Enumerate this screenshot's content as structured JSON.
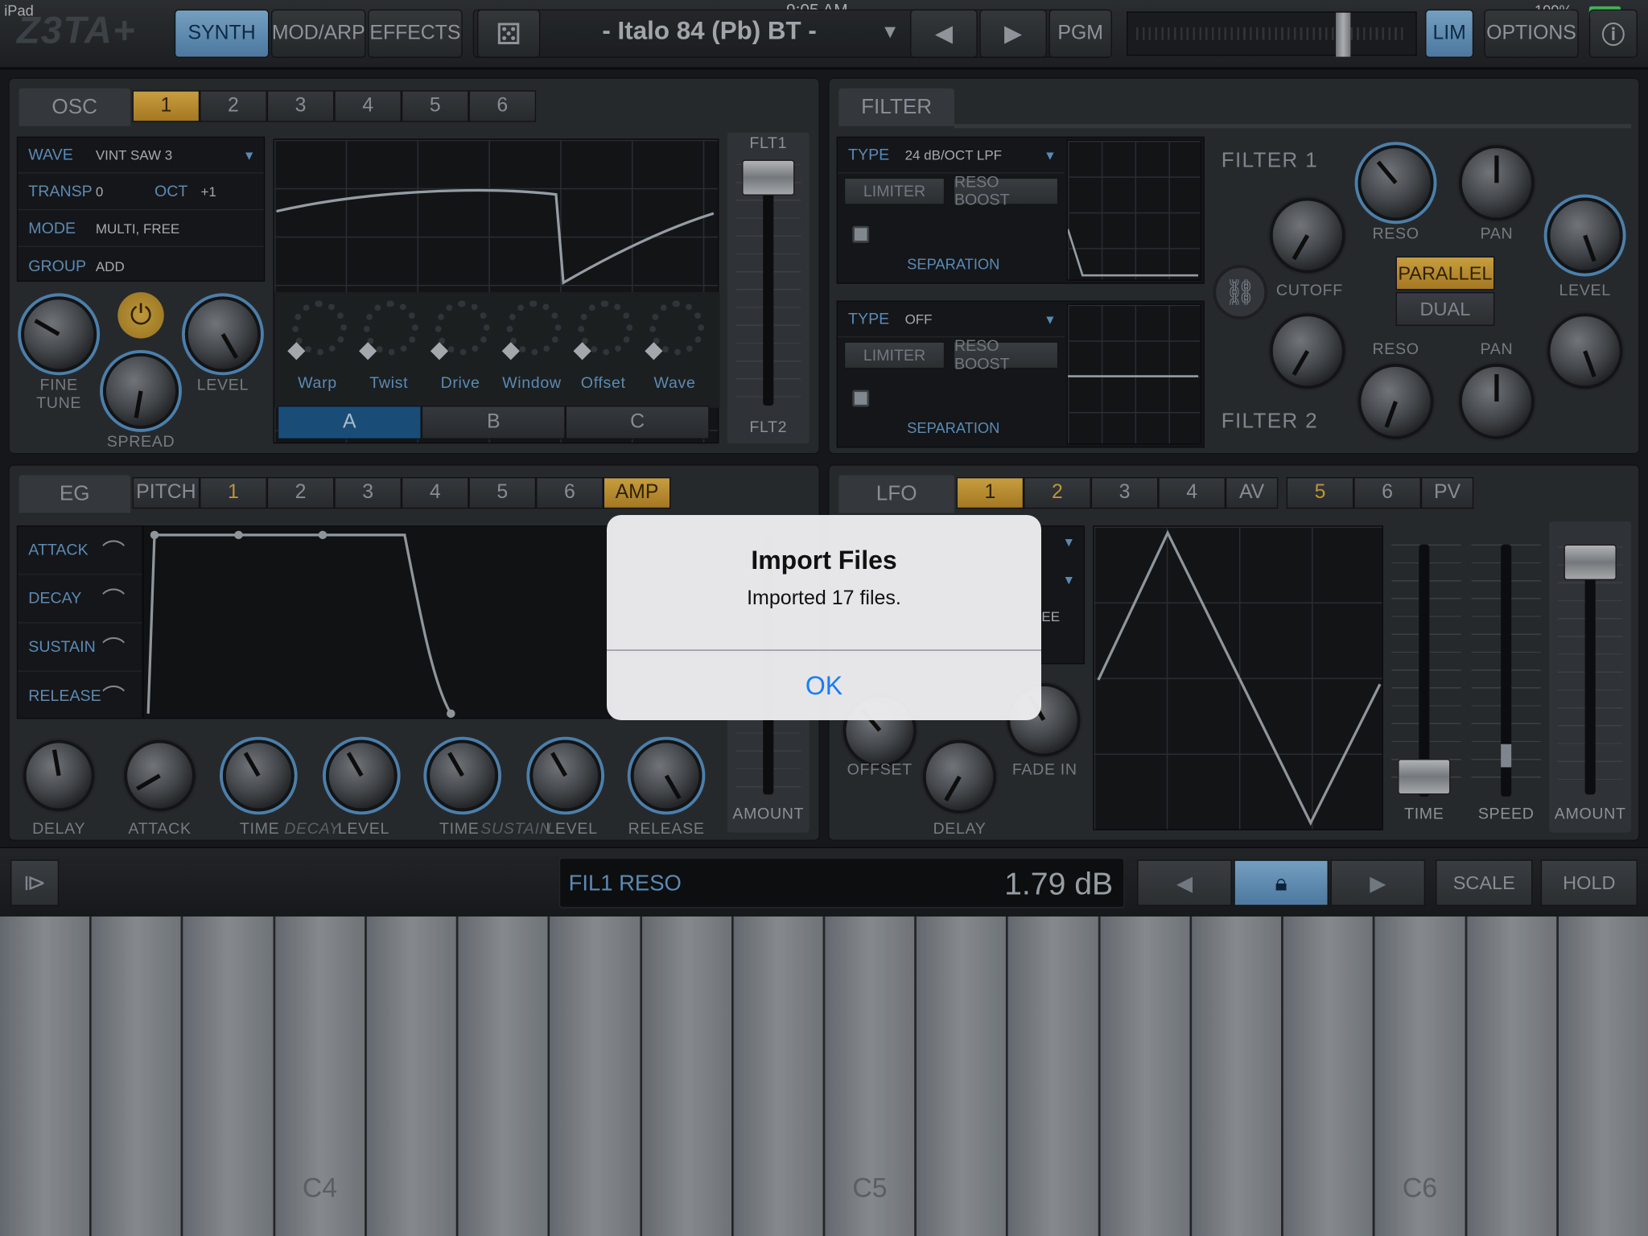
{
  "status_bar": {
    "device": "iPad",
    "time": "9:05 AM",
    "battery": "100%"
  },
  "topbar": {
    "logo": "Z3TA+",
    "tabs": [
      {
        "label": "SYNTH",
        "active": true
      },
      {
        "label": "MOD/ARP",
        "active": false
      },
      {
        "label": "EFFECTS",
        "active": false
      }
    ],
    "preset_name": "- Italo 84 (Pb) BT -",
    "pgm": "PGM",
    "lim": "LIM",
    "options": "OPTIONS"
  },
  "osc": {
    "title": "OSC",
    "tabs": [
      "1",
      "2",
      "3",
      "4",
      "5",
      "6"
    ],
    "active_tab": "1",
    "rows": {
      "wave_key": "WAVE",
      "wave_val": "VINT SAW 3",
      "transp_key": "TRANSP",
      "transp_val": "0",
      "oct_key": "OCT",
      "oct_val": "+1",
      "mode_key": "MODE",
      "mode_val": "MULTI, FREE",
      "group_key": "GROUP",
      "group_val": "ADD"
    },
    "knobs": {
      "fine_tune": "FINE\nTUNE",
      "spread": "SPREAD",
      "level": "LEVEL"
    },
    "shape_knobs": [
      "Warp",
      "Twist",
      "Drive",
      "Window",
      "Offset",
      "Wave"
    ],
    "abc": [
      "A",
      "B",
      "C"
    ],
    "flt1": "FLT1",
    "flt2": "FLT2"
  },
  "filter": {
    "title": "FILTER",
    "f1": {
      "type_key": "TYPE",
      "type_val": "24 dB/OCT LPF",
      "limiter": "LIMITER",
      "reso_boost": "RESO BOOST",
      "separation": "SEPARATION"
    },
    "f2": {
      "type_key": "TYPE",
      "type_val": "OFF",
      "limiter": "LIMITER",
      "reso_boost": "RESO BOOST",
      "separation": "SEPARATION"
    },
    "filter1_label": "FILTER 1",
    "filter2_label": "FILTER 2",
    "labels": {
      "reso": "RESO",
      "pan": "PAN",
      "cutoff": "CUTOFF",
      "level": "LEVEL"
    },
    "parallel": "PARALLEL",
    "dual": "DUAL"
  },
  "eg": {
    "title": "EG",
    "tabs": [
      "PITCH",
      "1",
      "2",
      "3",
      "4",
      "5",
      "6",
      "AMP"
    ],
    "stages": [
      "ATTACK",
      "DECAY",
      "SUSTAIN",
      "RELEASE"
    ],
    "knobs": [
      "DELAY",
      "ATTACK",
      "TIME",
      "LEVEL",
      "TIME",
      "LEVEL",
      "RELEASE"
    ],
    "decay": "DECAY",
    "sustain": "SUSTAIN",
    "amount": "AMOUNT"
  },
  "lfo": {
    "title": "LFO",
    "tabs": [
      "1",
      "2",
      "3",
      "4",
      "AV",
      "5",
      "6",
      "PV"
    ],
    "ee": "EE",
    "knobs": {
      "offset": "OFFSET",
      "delay": "DELAY",
      "fade_in": "FADE IN"
    },
    "faders": [
      "TIME",
      "SPEED",
      "AMOUNT"
    ]
  },
  "bottom": {
    "param_name": "FIL1 RESO",
    "param_value": "1.79 dB",
    "scale": "SCALE",
    "hold": "HOLD"
  },
  "keyboard": {
    "labels": [
      "C4",
      "C5",
      "C6"
    ]
  },
  "dialog": {
    "title": "Import Files",
    "message": "Imported 17 files.",
    "ok": "OK"
  },
  "colors": {
    "accent": "#6ea9dc",
    "gold": "#e7b645",
    "ios_blue": "#1a7cf5"
  }
}
